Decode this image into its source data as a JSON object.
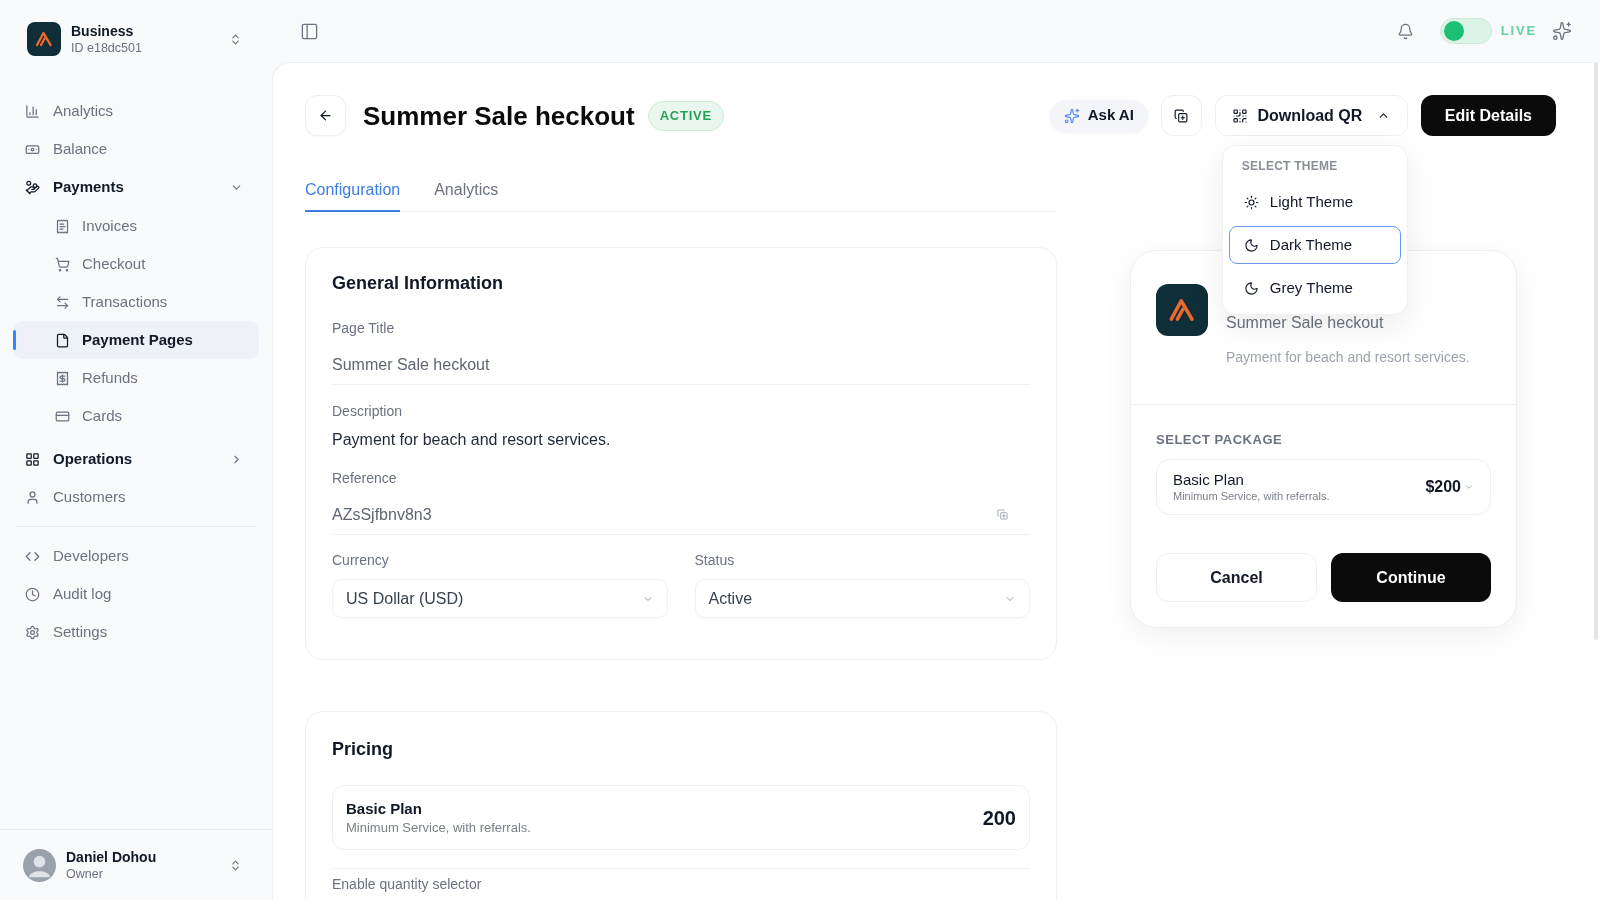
{
  "sidebar": {
    "workspace": {
      "name": "Business",
      "id": "ID e18dc501"
    },
    "nav": [
      {
        "label": "Analytics",
        "selected": false
      },
      {
        "label": "Balance",
        "selected": false
      },
      {
        "label": "Payments",
        "selected": false,
        "expanded": true,
        "children": [
          {
            "label": "Invoices",
            "selected": false
          },
          {
            "label": "Checkout",
            "selected": false
          },
          {
            "label": "Transactions",
            "selected": false
          },
          {
            "label": "Payment Pages",
            "selected": true
          },
          {
            "label": "Refunds",
            "selected": false
          },
          {
            "label": "Cards",
            "selected": false
          }
        ]
      },
      {
        "label": "Operations",
        "selected": false,
        "expanded": false
      },
      {
        "label": "Customers",
        "selected": false
      }
    ],
    "nav_secondary": [
      {
        "label": "Developers",
        "selected": false
      },
      {
        "label": "Audit log",
        "selected": false
      },
      {
        "label": "Settings",
        "selected": false
      }
    ],
    "user": {
      "name": "Daniel Dohou",
      "role": "Owner"
    }
  },
  "top_bar": {
    "mode_switch": {
      "on": false
    },
    "mode_label": "LIVE"
  },
  "page": {
    "title": "Summer Sale heckout",
    "status": "ACTIVE",
    "actions": {
      "ask_ai": "Ask AI",
      "download_qr": {
        "label": "Download QR",
        "expanded": true
      },
      "edit": "Edit Details"
    },
    "theme_menu": {
      "heading": "SELECT THEME",
      "items": [
        {
          "label": "Light Theme",
          "selected": false
        },
        {
          "label": "Dark Theme",
          "selected": true
        },
        {
          "label": "Grey Theme",
          "selected": false
        }
      ]
    },
    "tabs": [
      {
        "label": "Configuration",
        "selected": true
      },
      {
        "label": "Analytics",
        "selected": false
      }
    ],
    "general_information": {
      "title": "General Information",
      "fields": [
        {
          "kind": "input",
          "label": "Page Title",
          "value": "Summer Sale heckout",
          "copyable": false
        },
        {
          "kind": "text",
          "label": "Description",
          "value": "Payment for beach and resort services.",
          "copyable": false
        },
        {
          "kind": "input",
          "label": "Reference",
          "value": "AZsSjfbnv8n3",
          "copyable": true
        }
      ],
      "selects": [
        {
          "label": "Currency",
          "value": "US Dollar (USD)"
        },
        {
          "label": "Status",
          "value": "Active"
        }
      ]
    },
    "pricing": {
      "title": "Pricing",
      "plans": [
        {
          "name": "Basic Plan",
          "description": "Minimum Service, with referrals.",
          "amount": "200"
        }
      ],
      "next_label": "Enable quantity selector"
    },
    "preview": {
      "title": "Summer Sale heckout",
      "description": "Payment for beach and resort services.",
      "package_heading": "SELECT PACKAGE",
      "package": {
        "name": "Basic Plan",
        "description": "Minimum Service, with referrals.",
        "price": "$200"
      },
      "cancel": "Cancel",
      "continue": "Continue"
    }
  }
}
